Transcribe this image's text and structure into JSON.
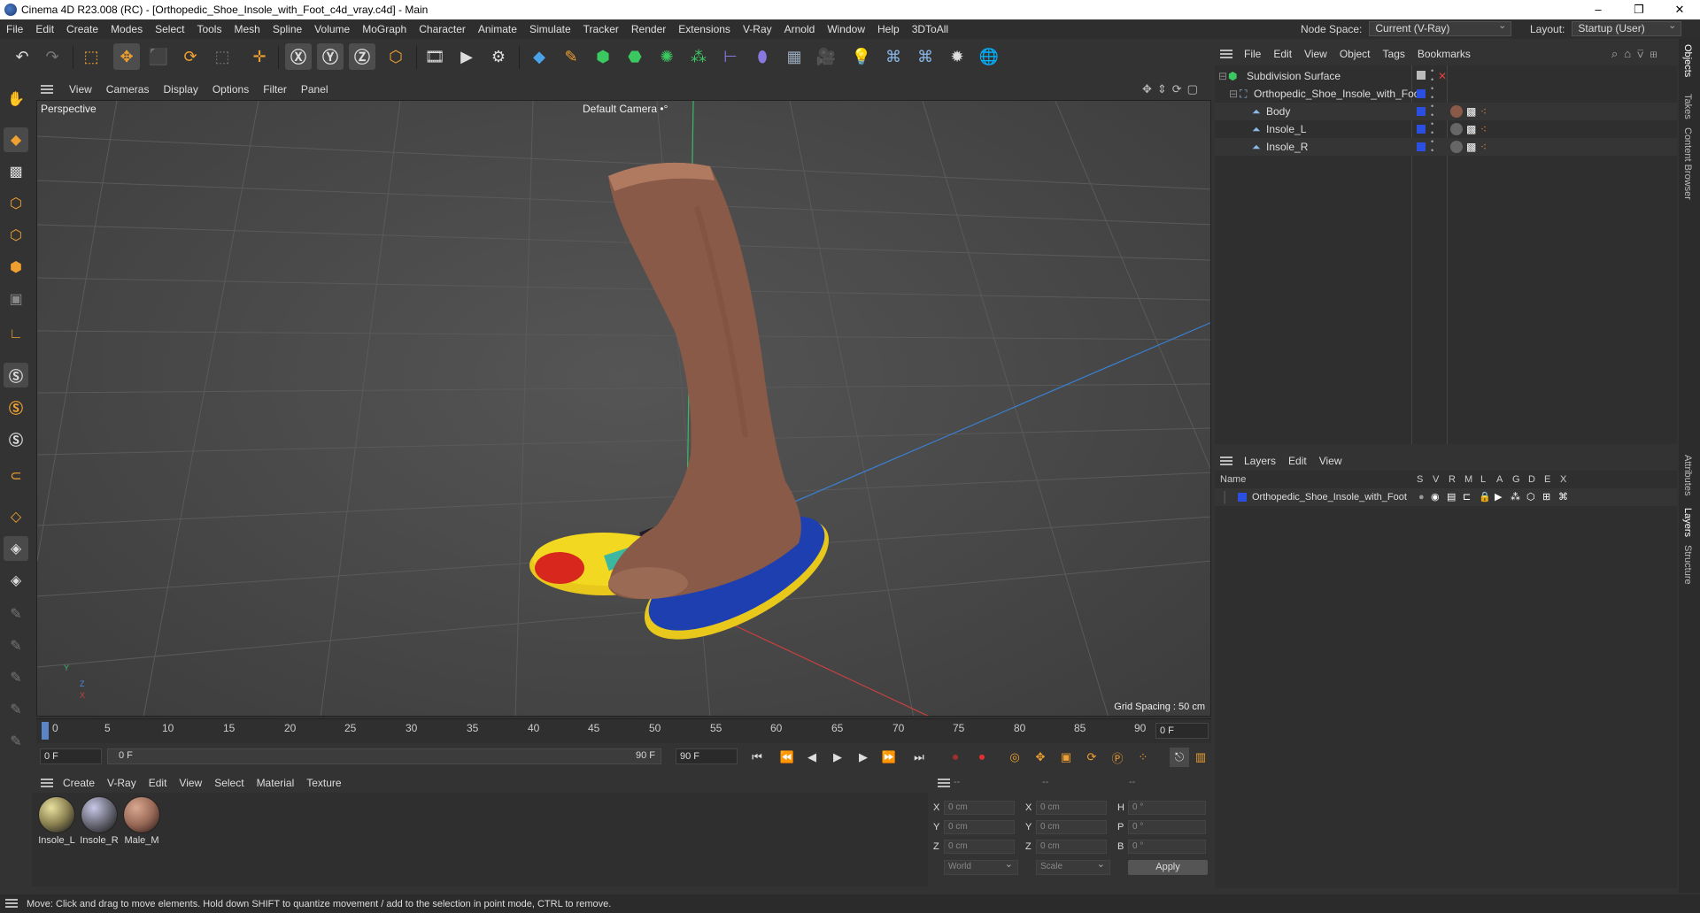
{
  "window": {
    "title": "Cinema 4D R23.008 (RC) - [Orthopedic_Shoe_Insole_with_Foot_c4d_vray.c4d] - Main",
    "minimize": "–",
    "maximize": "❐",
    "close": "✕"
  },
  "menubar": {
    "items": [
      "File",
      "Edit",
      "Create",
      "Modes",
      "Select",
      "Tools",
      "Mesh",
      "Spline",
      "Volume",
      "MoGraph",
      "Character",
      "Animate",
      "Simulate",
      "Tracker",
      "Render",
      "Extensions",
      "V-Ray",
      "Arnold",
      "Window",
      "Help",
      "3DToAll"
    ],
    "node_space_label": "Node Space:",
    "node_space_value": "Current (V-Ray)",
    "layout_label": "Layout:",
    "layout_value": "Startup (User)"
  },
  "viewport": {
    "menu": [
      "View",
      "Cameras",
      "Display",
      "Options",
      "Filter",
      "Panel"
    ],
    "projection": "Perspective",
    "camera": "Default Camera",
    "camera_icon": "•°",
    "grid_spacing": "Grid Spacing : 50 cm",
    "axis_y": "Y",
    "axis_z": "Z",
    "axis_x": "X"
  },
  "timeline": {
    "ticks": [
      "0",
      "5",
      "10",
      "15",
      "20",
      "25",
      "30",
      "35",
      "40",
      "45",
      "50",
      "55",
      "60",
      "65",
      "70",
      "75",
      "80",
      "85",
      "90"
    ],
    "current_frame": "0 F",
    "start_frame": "0 F",
    "range_start": "0 F",
    "range_end": "90 F",
    "end_frame": "90 F"
  },
  "material_manager": {
    "menu": [
      "Create",
      "V-Ray",
      "Edit",
      "View",
      "Select",
      "Material",
      "Texture"
    ],
    "materials": [
      {
        "name": "Insole_L",
        "color": "#8a8050"
      },
      {
        "name": "Insole_R",
        "color": "#6a6a78"
      },
      {
        "name": "Male_M",
        "color": "#9a6a58"
      }
    ]
  },
  "coordinates": {
    "header": [
      "--",
      "--",
      "--"
    ],
    "rows": [
      {
        "l1": "X",
        "v1": "0 cm",
        "l2": "X",
        "v2": "0 cm",
        "l3": "H",
        "v3": "0 °"
      },
      {
        "l1": "Y",
        "v1": "0 cm",
        "l2": "Y",
        "v2": "0 cm",
        "l3": "P",
        "v3": "0 °"
      },
      {
        "l1": "Z",
        "v1": "0 cm",
        "l2": "Z",
        "v2": "0 cm",
        "l3": "B",
        "v3": "0 °"
      }
    ],
    "mode_world": "World",
    "mode_scale": "Scale",
    "apply": "Apply"
  },
  "object_manager": {
    "menu": [
      "File",
      "Edit",
      "View",
      "Object",
      "Tags",
      "Bookmarks"
    ],
    "objects": [
      {
        "name": "Subdivision Surface"
      },
      {
        "name": "Orthopedic_Shoe_Insole_with_Foot"
      },
      {
        "name": "Body"
      },
      {
        "name": "Insole_L"
      },
      {
        "name": "Insole_R"
      }
    ]
  },
  "layer_manager": {
    "menu": [
      "Layers",
      "Edit",
      "View"
    ],
    "col_name": "Name",
    "col_flags": [
      "S",
      "V",
      "R",
      "M",
      "L",
      "A",
      "G",
      "D",
      "E",
      "X"
    ],
    "layers": [
      {
        "name": "Orthopedic_Shoe_Insole_with_Foot",
        "color": "#2b4fe0"
      }
    ]
  },
  "side_tabs": [
    "Objects",
    "Takes",
    "Content Browser",
    "Attributes",
    "Layers",
    "Structure"
  ],
  "status": "Move: Click and drag to move elements. Hold down SHIFT to quantize movement / add to the selection in point mode, CTRL to remove."
}
